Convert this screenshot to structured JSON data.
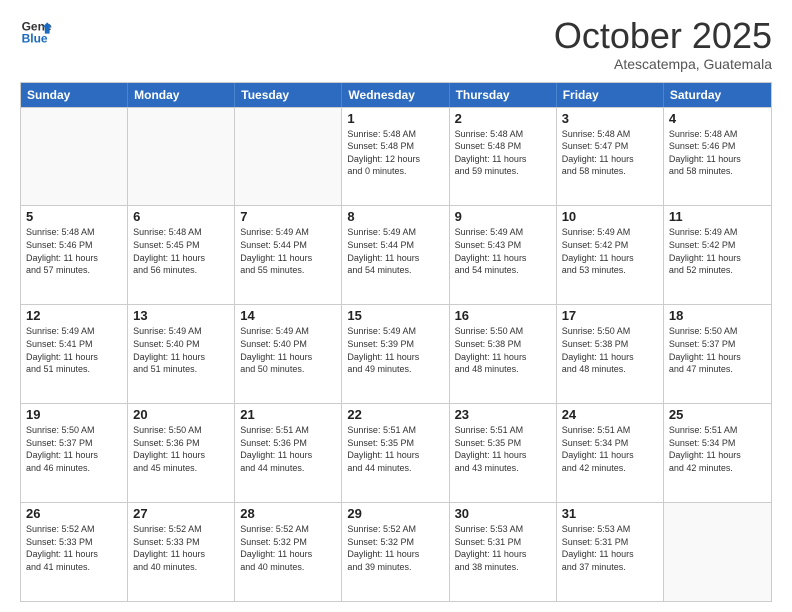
{
  "logo": {
    "line1": "General",
    "line2": "Blue"
  },
  "title": "October 2025",
  "subtitle": "Atescatempa, Guatemala",
  "weekdays": [
    "Sunday",
    "Monday",
    "Tuesday",
    "Wednesday",
    "Thursday",
    "Friday",
    "Saturday"
  ],
  "rows": [
    [
      {
        "day": "",
        "text": ""
      },
      {
        "day": "",
        "text": ""
      },
      {
        "day": "",
        "text": ""
      },
      {
        "day": "1",
        "text": "Sunrise: 5:48 AM\nSunset: 5:48 PM\nDaylight: 12 hours\nand 0 minutes."
      },
      {
        "day": "2",
        "text": "Sunrise: 5:48 AM\nSunset: 5:48 PM\nDaylight: 11 hours\nand 59 minutes."
      },
      {
        "day": "3",
        "text": "Sunrise: 5:48 AM\nSunset: 5:47 PM\nDaylight: 11 hours\nand 58 minutes."
      },
      {
        "day": "4",
        "text": "Sunrise: 5:48 AM\nSunset: 5:46 PM\nDaylight: 11 hours\nand 58 minutes."
      }
    ],
    [
      {
        "day": "5",
        "text": "Sunrise: 5:48 AM\nSunset: 5:46 PM\nDaylight: 11 hours\nand 57 minutes."
      },
      {
        "day": "6",
        "text": "Sunrise: 5:48 AM\nSunset: 5:45 PM\nDaylight: 11 hours\nand 56 minutes."
      },
      {
        "day": "7",
        "text": "Sunrise: 5:49 AM\nSunset: 5:44 PM\nDaylight: 11 hours\nand 55 minutes."
      },
      {
        "day": "8",
        "text": "Sunrise: 5:49 AM\nSunset: 5:44 PM\nDaylight: 11 hours\nand 54 minutes."
      },
      {
        "day": "9",
        "text": "Sunrise: 5:49 AM\nSunset: 5:43 PM\nDaylight: 11 hours\nand 54 minutes."
      },
      {
        "day": "10",
        "text": "Sunrise: 5:49 AM\nSunset: 5:42 PM\nDaylight: 11 hours\nand 53 minutes."
      },
      {
        "day": "11",
        "text": "Sunrise: 5:49 AM\nSunset: 5:42 PM\nDaylight: 11 hours\nand 52 minutes."
      }
    ],
    [
      {
        "day": "12",
        "text": "Sunrise: 5:49 AM\nSunset: 5:41 PM\nDaylight: 11 hours\nand 51 minutes."
      },
      {
        "day": "13",
        "text": "Sunrise: 5:49 AM\nSunset: 5:40 PM\nDaylight: 11 hours\nand 51 minutes."
      },
      {
        "day": "14",
        "text": "Sunrise: 5:49 AM\nSunset: 5:40 PM\nDaylight: 11 hours\nand 50 minutes."
      },
      {
        "day": "15",
        "text": "Sunrise: 5:49 AM\nSunset: 5:39 PM\nDaylight: 11 hours\nand 49 minutes."
      },
      {
        "day": "16",
        "text": "Sunrise: 5:50 AM\nSunset: 5:38 PM\nDaylight: 11 hours\nand 48 minutes."
      },
      {
        "day": "17",
        "text": "Sunrise: 5:50 AM\nSunset: 5:38 PM\nDaylight: 11 hours\nand 48 minutes."
      },
      {
        "day": "18",
        "text": "Sunrise: 5:50 AM\nSunset: 5:37 PM\nDaylight: 11 hours\nand 47 minutes."
      }
    ],
    [
      {
        "day": "19",
        "text": "Sunrise: 5:50 AM\nSunset: 5:37 PM\nDaylight: 11 hours\nand 46 minutes."
      },
      {
        "day": "20",
        "text": "Sunrise: 5:50 AM\nSunset: 5:36 PM\nDaylight: 11 hours\nand 45 minutes."
      },
      {
        "day": "21",
        "text": "Sunrise: 5:51 AM\nSunset: 5:36 PM\nDaylight: 11 hours\nand 44 minutes."
      },
      {
        "day": "22",
        "text": "Sunrise: 5:51 AM\nSunset: 5:35 PM\nDaylight: 11 hours\nand 44 minutes."
      },
      {
        "day": "23",
        "text": "Sunrise: 5:51 AM\nSunset: 5:35 PM\nDaylight: 11 hours\nand 43 minutes."
      },
      {
        "day": "24",
        "text": "Sunrise: 5:51 AM\nSunset: 5:34 PM\nDaylight: 11 hours\nand 42 minutes."
      },
      {
        "day": "25",
        "text": "Sunrise: 5:51 AM\nSunset: 5:34 PM\nDaylight: 11 hours\nand 42 minutes."
      }
    ],
    [
      {
        "day": "26",
        "text": "Sunrise: 5:52 AM\nSunset: 5:33 PM\nDaylight: 11 hours\nand 41 minutes."
      },
      {
        "day": "27",
        "text": "Sunrise: 5:52 AM\nSunset: 5:33 PM\nDaylight: 11 hours\nand 40 minutes."
      },
      {
        "day": "28",
        "text": "Sunrise: 5:52 AM\nSunset: 5:32 PM\nDaylight: 11 hours\nand 40 minutes."
      },
      {
        "day": "29",
        "text": "Sunrise: 5:52 AM\nSunset: 5:32 PM\nDaylight: 11 hours\nand 39 minutes."
      },
      {
        "day": "30",
        "text": "Sunrise: 5:53 AM\nSunset: 5:31 PM\nDaylight: 11 hours\nand 38 minutes."
      },
      {
        "day": "31",
        "text": "Sunrise: 5:53 AM\nSunset: 5:31 PM\nDaylight: 11 hours\nand 37 minutes."
      },
      {
        "day": "",
        "text": ""
      }
    ]
  ]
}
